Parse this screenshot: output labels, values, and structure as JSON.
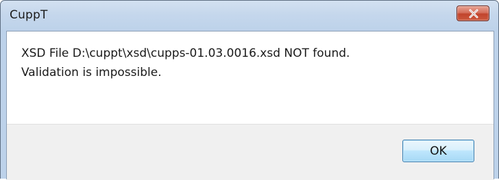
{
  "window": {
    "title": "CuppT",
    "close_icon": "close-x-icon"
  },
  "message": {
    "line1": "XSD File D:\\cuppt\\xsd\\cupps-01.03.0016.xsd NOT found.",
    "line2": "Validation is impossible."
  },
  "buttons": {
    "ok_label": "OK"
  },
  "colors": {
    "titlebar": "#c5d7ec",
    "close_button": "#c7503a",
    "ok_button_border": "#3c7fb1",
    "button_area": "#f0f0f0"
  }
}
